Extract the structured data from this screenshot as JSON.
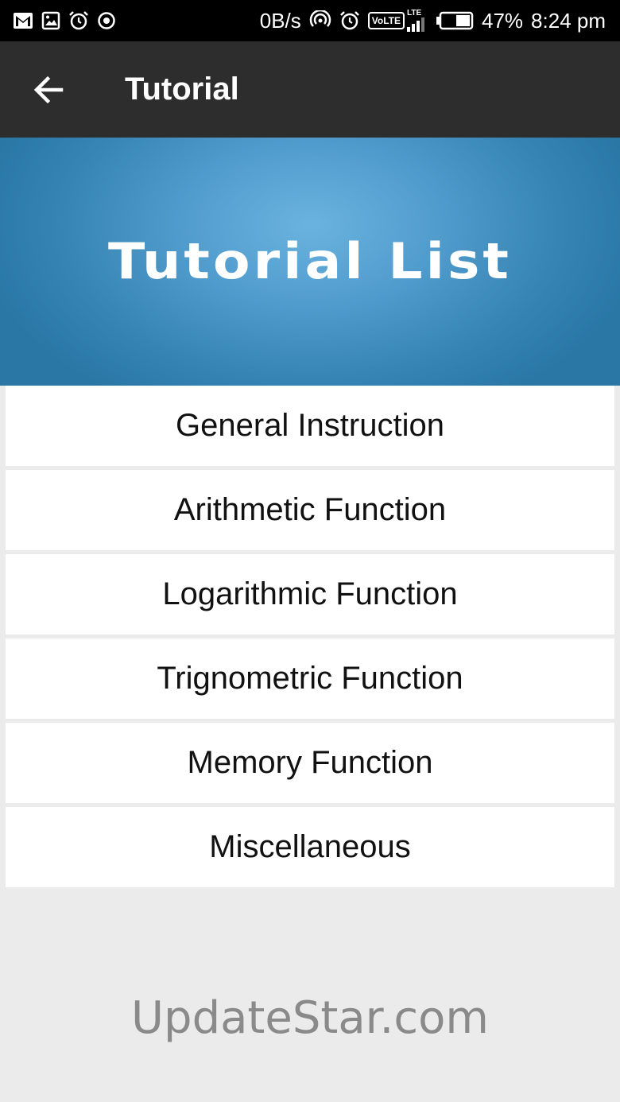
{
  "status_bar": {
    "left_icons": [
      "gmail-icon",
      "gallery-icon",
      "alarm-icon",
      "sync-icon"
    ],
    "network_speed": "0B/s",
    "volte_label": "VoLTE",
    "lte_label": "LTE",
    "battery": "47%",
    "time": "8:24 pm"
  },
  "toolbar": {
    "back_icon": "arrow-left-icon",
    "title": "Tutorial"
  },
  "banner": {
    "title": "Tutorial List",
    "colors": {
      "center": "#6ab3e0",
      "edge": "#2a77a6"
    }
  },
  "tutorial_list": {
    "items": [
      {
        "label": "General Instruction"
      },
      {
        "label": "Arithmetic Function"
      },
      {
        "label": "Logarithmic Function"
      },
      {
        "label": "Trignometric Function"
      },
      {
        "label": "Memory Function"
      },
      {
        "label": "Miscellaneous"
      }
    ]
  },
  "watermark": "UpdateStar.com"
}
